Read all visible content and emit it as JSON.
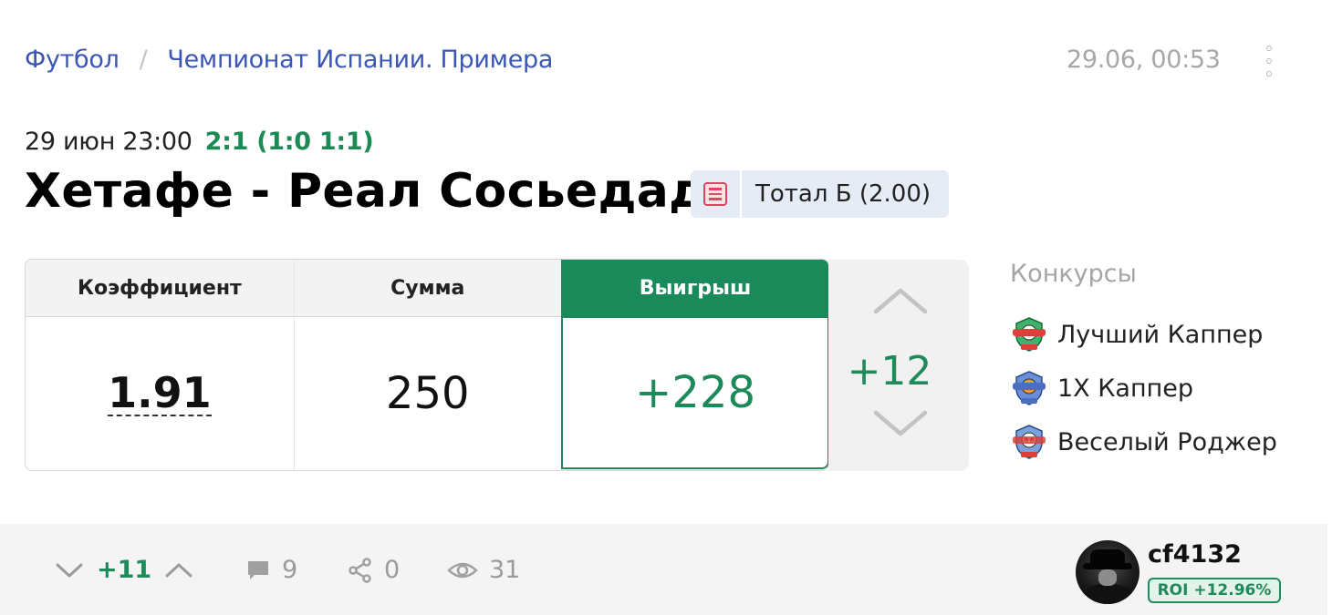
{
  "breadcrumb": {
    "sport": "Футбол",
    "separator": "/",
    "league": "Чемпионат Испании. Примера"
  },
  "timestamp": "29.06, 00:53",
  "match": {
    "datetime": "29 июн 23:00",
    "score": "2:1 (1:0 1:1)",
    "title": "Хетафе - Реал Сосьедад",
    "bet_label": "Тотал Б (2.00)"
  },
  "bet": {
    "coef_header": "Коэффициент",
    "sum_header": "Сумма",
    "win_header": "Выигрыш",
    "coef": "1.91",
    "sum": "250",
    "win": "+228"
  },
  "vote": {
    "count": "+12"
  },
  "contests": {
    "title": "Конкурсы",
    "items": [
      {
        "label": "Лучший Каппер",
        "icon": "best-capper-badge-icon"
      },
      {
        "label": "1X Каппер",
        "icon": "1x-capper-badge-icon"
      },
      {
        "label": "Веселый Роджер",
        "icon": "jolly-roger-badge-icon"
      }
    ]
  },
  "footer": {
    "rating": "+11",
    "comments": "9",
    "shares": "0",
    "views": "31"
  },
  "user": {
    "name": "cf4132",
    "roi": "ROI  +12.96%"
  },
  "colors": {
    "accent_green": "#1a8a5a",
    "link_blue": "#3a57b5",
    "tag_red": "#e2445c"
  }
}
